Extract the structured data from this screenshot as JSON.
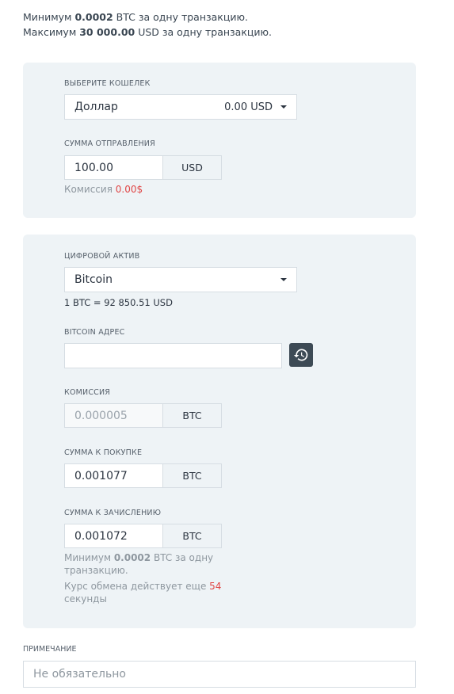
{
  "limits": {
    "min_prefix": "Минимум ",
    "min_value": "0.0002",
    "min_suffix": " BTC за одну транзакцию.",
    "max_prefix": "Максимум ",
    "max_value": "30 000.00",
    "max_suffix": " USD за одну транзакцию."
  },
  "wallet": {
    "label": "ВЫБЕРИТЕ КОШЕЛЕК",
    "selected": "Доллар",
    "balance": "0.00 USD"
  },
  "send_amount": {
    "label": "СУММА ОТПРАВЛЕНИЯ",
    "value": "100.00",
    "unit": "USD",
    "fee_label": "Комиссия ",
    "fee_value": "0.00$"
  },
  "asset": {
    "label": "ЦИФРОВОЙ АКТИВ",
    "selected": "Bitcoin",
    "rate": "1 BTC = 92 850.51 USD"
  },
  "address": {
    "label": "BITCOIN АДРЕС",
    "value": "",
    "history_icon": "history-icon"
  },
  "commission": {
    "label": "КОМИССИЯ",
    "value": "0.000005",
    "unit": "BTC"
  },
  "buy_amount": {
    "label": "СУММА К ПОКУПКЕ",
    "value": "0.001077",
    "unit": "BTC"
  },
  "credit_amount": {
    "label": "СУММА К ЗАЧИСЛЕНИЮ",
    "value": "0.001072",
    "unit": "BTC",
    "min_prefix": "Минимум ",
    "min_value": "0.0002",
    "min_suffix_line1": " BTC за одну",
    "min_suffix_line2": "транзакцию.",
    "rate_valid_line1": "Курс обмена действует еще ",
    "rate_valid_seconds": "54",
    "rate_valid_line2": "секунды"
  },
  "comment": {
    "label": "ПРИМЕЧАНИЕ",
    "placeholder": "Не обязательно"
  },
  "colors": {
    "panel_bg": "#eef3f6",
    "accent_red": "#e04646",
    "text_dark": "#2b3440",
    "button_dark": "#3d4a55"
  }
}
